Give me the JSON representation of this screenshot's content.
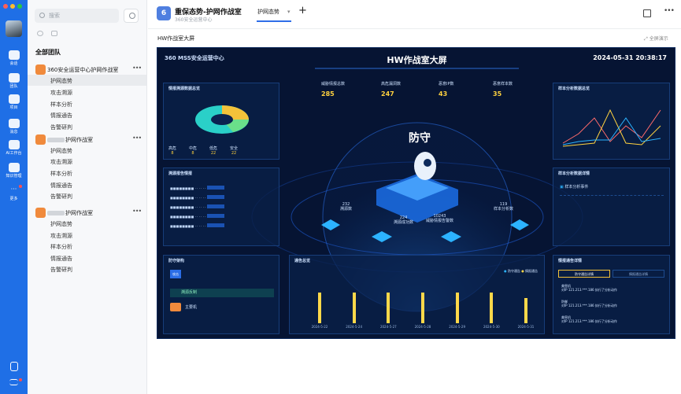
{
  "sidebar": {
    "search_placeholder": "搜索",
    "section_title": "全部团队",
    "groups": [
      {
        "name": "360安全运营中心护网作战室",
        "subs": [
          "护网态势",
          "攻击溯源",
          "样本分析",
          "情报通告",
          "告警研判"
        ]
      },
      {
        "name": "护网作战室",
        "subs": [
          "护网态势",
          "攻击溯源",
          "样本分析",
          "情报通告",
          "告警研判"
        ]
      },
      {
        "name": "护网作战室",
        "subs": [
          "护网态势",
          "攻击溯源",
          "样本分析",
          "情报通告",
          "告警研判"
        ]
      }
    ]
  },
  "rail": {
    "items": [
      {
        "label": "会话"
      },
      {
        "label": "团队"
      },
      {
        "label": "项目"
      },
      {
        "label": "消息"
      },
      {
        "label": "AI工作台"
      },
      {
        "label": "知识管理"
      },
      {
        "label": "更多"
      }
    ]
  },
  "header": {
    "icon_text": "6",
    "title": "重保态势-护网作战室",
    "subtitle": "360安全运营中心",
    "tab_label": "护网态势",
    "tab_close": "▾",
    "add_label": "+",
    "more_label": "•••"
  },
  "content": {
    "title": "HW作战室大屏",
    "fullscreen_label": "全屏演示"
  },
  "dashboard": {
    "logo": "360 MSS安全运营中心",
    "title": "HW作战室大屏",
    "datetime": "2024-05-31 20:38:17",
    "stats": [
      {
        "label": "威胁情报总数",
        "value": "285"
      },
      {
        "label": "高危漏洞数",
        "value": "247"
      },
      {
        "label": "恶意IP数",
        "value": "43"
      },
      {
        "label": "恶意样本数",
        "value": "35"
      }
    ],
    "panels": {
      "intel_sources": "情报溯源数据总览",
      "trace_report": "溯源报告情报",
      "defense_arch": "防守架构",
      "notice_overview": "通告总览",
      "sample_overview": "样本分析数据总览",
      "sample_detail": "样本分析数据详情",
      "intel_detail": "情报通告详情"
    },
    "center_label": "防守",
    "nodes": [
      {
        "value": "232",
        "label": "溯源数"
      },
      {
        "value": "224",
        "label": "溯源成功数"
      },
      {
        "value": "10243",
        "label": "威胁情报告警数"
      },
      {
        "value": "119",
        "label": "样本分析数"
      }
    ],
    "pie_legend": [
      "高危",
      "中危",
      "低危",
      "安全"
    ],
    "pie_values": [
      "8",
      "8",
      "22",
      "22"
    ],
    "defense_rows": [
      "攻击",
      "溯源反制",
      "主要机"
    ],
    "sample_event": "样本分析事件",
    "intel_tabs": [
      "防守通告详情",
      "情报通告详情"
    ],
    "intel_items": [
      {
        "tag": "美窖机",
        "text": "对IP 121.213.***.186 执行了分析动作"
      },
      {
        "tag": "防御",
        "text": "对IP 121.213.***.186 执行了分析动作"
      },
      {
        "tag": "美窖机",
        "text": "对IP 121.213.***.186 执行了分析动作"
      }
    ],
    "notice_dates": [
      "2024-5-22",
      "2024-5-24",
      "2024-5-27",
      "2024-5-28",
      "2024-5-29",
      "2024-5-30",
      "2024-5-31"
    ]
  },
  "chart_data": {
    "type": "bar",
    "title": "通告总览",
    "categories": [
      "2024-5-22",
      "2024-5-24",
      "2024-5-27",
      "2024-5-28",
      "2024-5-29",
      "2024-5-30",
      "2024-5-31"
    ],
    "series": [
      {
        "name": "防守通告",
        "values": [
          0,
          0,
          0,
          0,
          0,
          0,
          0
        ]
      },
      {
        "name": "情报通告",
        "values": [
          6,
          6,
          6,
          6,
          6,
          6,
          5
        ]
      }
    ],
    "ylim": [
      0,
      8
    ]
  },
  "colors": {
    "accent": "#2f6ee8",
    "rail": "#1f6fe6",
    "dash_bg": "#061433",
    "value": "#ffd23f"
  }
}
